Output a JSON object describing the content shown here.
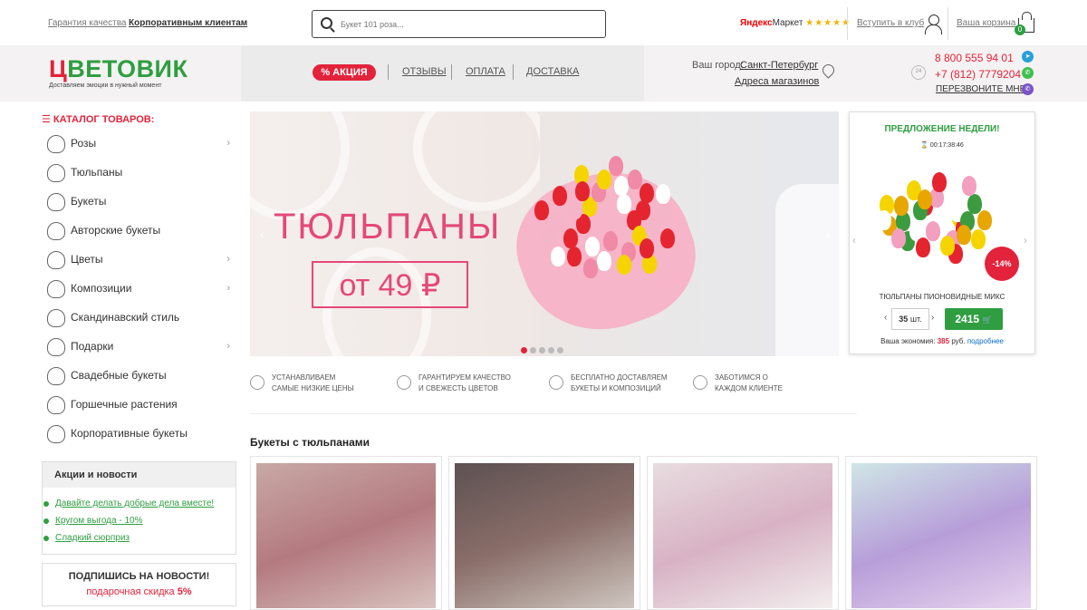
{
  "topbar": {
    "guarantee": "Гарантия качества",
    "corporate": "Корпоративным клиентам",
    "search_placeholder": "Букет 101 роза...",
    "ym_brand": "Яндекс",
    "ym_market": "Маркет",
    "ym_stars": "★★★★★",
    "club": "Вступить в клуб",
    "cart": "Ваша корзина",
    "cart_count": "0"
  },
  "header": {
    "logo_first": "Ц",
    "logo_rest": "ВЕТОВИК",
    "logo_tagline": "Доставляем эмоции в нужный момент",
    "promo": "% АКЦИЯ",
    "nav": [
      "ОТЗЫВЫ",
      "ОПЛАТА",
      "ДОСТАВКА"
    ],
    "city_label": "Ваш город:",
    "city": "Санкт-Петербург",
    "addresses": "Адреса магазинов",
    "phone1": "8 800 555 94 01",
    "phone2": "+7 (812) 7779204",
    "callback": "ПЕРЕЗВОНИТЕ МНЕ",
    "badge24": "24"
  },
  "catalog": {
    "title": "☰ КАТАЛОГ ТОВАРОВ:",
    "items": [
      {
        "label": "Розы",
        "arrow": "›"
      },
      {
        "label": "Тюльпаны",
        "arrow": ""
      },
      {
        "label": "Букеты",
        "arrow": ""
      },
      {
        "label": "Авторские букеты",
        "arrow": ""
      },
      {
        "label": "Цветы",
        "arrow": "›"
      },
      {
        "label": "Композиции",
        "arrow": "›"
      },
      {
        "label": "Скандинавский стиль",
        "arrow": ""
      },
      {
        "label": "Подарки",
        "arrow": "›"
      },
      {
        "label": "Свадебные букеты",
        "arrow": ""
      },
      {
        "label": "Горшечные растения",
        "arrow": ""
      },
      {
        "label": "Корпоративные букеты",
        "arrow": ""
      }
    ]
  },
  "promos": {
    "title": "Акции и новости",
    "items": [
      "Давайте делать добрые дела вместе!",
      "Кругом выгода - 10%",
      "Сладкий сюрприз"
    ]
  },
  "subscribe": {
    "title": "ПОДПИШИСЬ НА НОВОСТИ!",
    "discount_prefix": "подарочная скидка",
    "discount_value": "5%"
  },
  "banner": {
    "title": "ТЮЛЬПАНЫ",
    "price": "от 49 ₽",
    "slides": 5,
    "active_slide": 1
  },
  "features": [
    {
      "line1": "УСТАНАВЛИВАЕМ",
      "line2": "САМЫЕ НИЗКИЕ ЦЕНЫ"
    },
    {
      "line1": "ГАРАНТИРУЕМ КАЧЕСТВО",
      "line2": "И СВЕЖЕСТЬ ЦВЕТОВ"
    },
    {
      "line1": "БЕСПЛАТНО ДОСТАВЛЯЕМ",
      "line2": "БУКЕТЫ И КОМПОЗИЦИЙ"
    },
    {
      "line1": "ЗАБОТИМСЯ О",
      "line2": "КАЖДОМ КЛИЕНТЕ"
    }
  ],
  "weekly": {
    "title": "ПРЕДЛОЖЕНИЕ НЕДЕЛИ!",
    "timer": "00:17:38:46",
    "discount": "-14%",
    "name": "ТЮЛЬПАНЫ ПИОНОВИДНЫЕ МИКС",
    "qty": "35",
    "qty_unit": "шт.",
    "price": "2415",
    "cart_icon": "🛒",
    "economy_label": "Ваша экономия:",
    "economy_value": "385",
    "economy_unit": "руб.",
    "more": "подробнее"
  },
  "section": {
    "title": "Букеты с тюльпанами"
  },
  "colors": {
    "brand_red": "#e2233b",
    "brand_green": "#2f9e41"
  }
}
